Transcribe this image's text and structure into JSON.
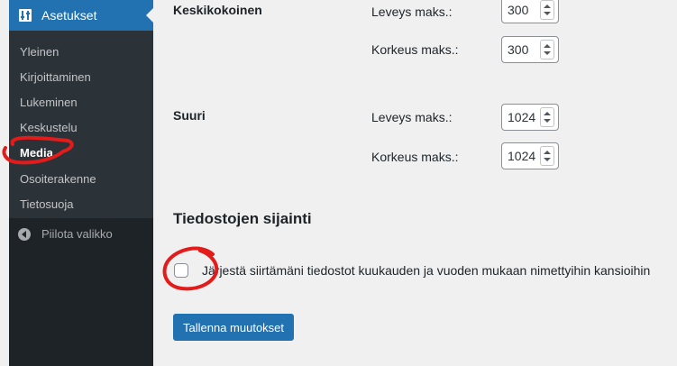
{
  "sidebar": {
    "header": {
      "label": "Asetukset",
      "icon": "settings-sliders-icon"
    },
    "items": [
      {
        "label": "Yleinen"
      },
      {
        "label": "Kirjoittaminen"
      },
      {
        "label": "Lukeminen"
      },
      {
        "label": "Keskustelu"
      },
      {
        "label": "Media",
        "current": true
      },
      {
        "label": "Osoiterakenne"
      },
      {
        "label": "Tietosuoja"
      }
    ],
    "collapse_label": "Piilota valikko"
  },
  "sizes": {
    "medium": {
      "label": "Keskikokoinen",
      "width_label": "Leveys maks.:",
      "width_value": "300",
      "height_label": "Korkeus maks.:",
      "height_value": "300"
    },
    "large": {
      "label": "Suuri",
      "width_label": "Leveys maks.:",
      "width_value": "1024",
      "height_label": "Korkeus maks.:",
      "height_value": "1024"
    }
  },
  "uploads": {
    "title": "Tiedostojen sijainti",
    "organize_label": "Järjestä siirtämäni tiedostot kuukauden ja vuoden mukaan nimettyihin kansioihin",
    "organize_checked": false
  },
  "save_label": "Tallenna muutokset",
  "colors": {
    "accent": "#2271b1",
    "sidebar_bg": "#1d2327",
    "submenu_bg": "#2c3338",
    "annotation": "#e21b1b"
  }
}
